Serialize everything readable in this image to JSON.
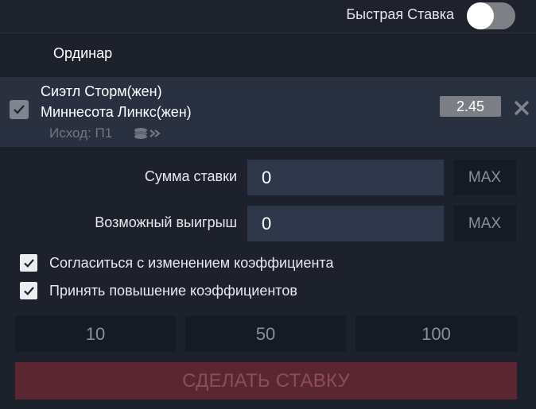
{
  "header": {
    "quick_bet_label": "Быстрая Ставка",
    "quick_bet_enabled": false
  },
  "section_title": "Ординар",
  "event": {
    "selected": true,
    "team1": "Сиэтл Сторм(жен)",
    "team2": "Миннесота Линкс(жен)",
    "outcome": "Исход: П1",
    "odds": "2.45",
    "icons": [
      "checkbox-check-icon",
      "coins-icon",
      "close-icon"
    ]
  },
  "form": {
    "stake_label": "Сумма ставки",
    "stake_value": "0",
    "win_label": "Возможный выигрыш",
    "win_value": "0",
    "max_label": "MAX"
  },
  "options": {
    "accept_change_label": "Согласиться с изменением коэффициента",
    "accept_change_checked": true,
    "accept_raise_label": "Принять повышение коэффициентов",
    "accept_raise_checked": true
  },
  "quick_amounts": [
    "10",
    "50",
    "100"
  ],
  "submit_label": "СДЕЛАТЬ СТАВКУ",
  "colors": {
    "background": "#1c212b",
    "event_row": "#293140",
    "input": "#2e3749",
    "submit_disabled": "#5a2631"
  }
}
